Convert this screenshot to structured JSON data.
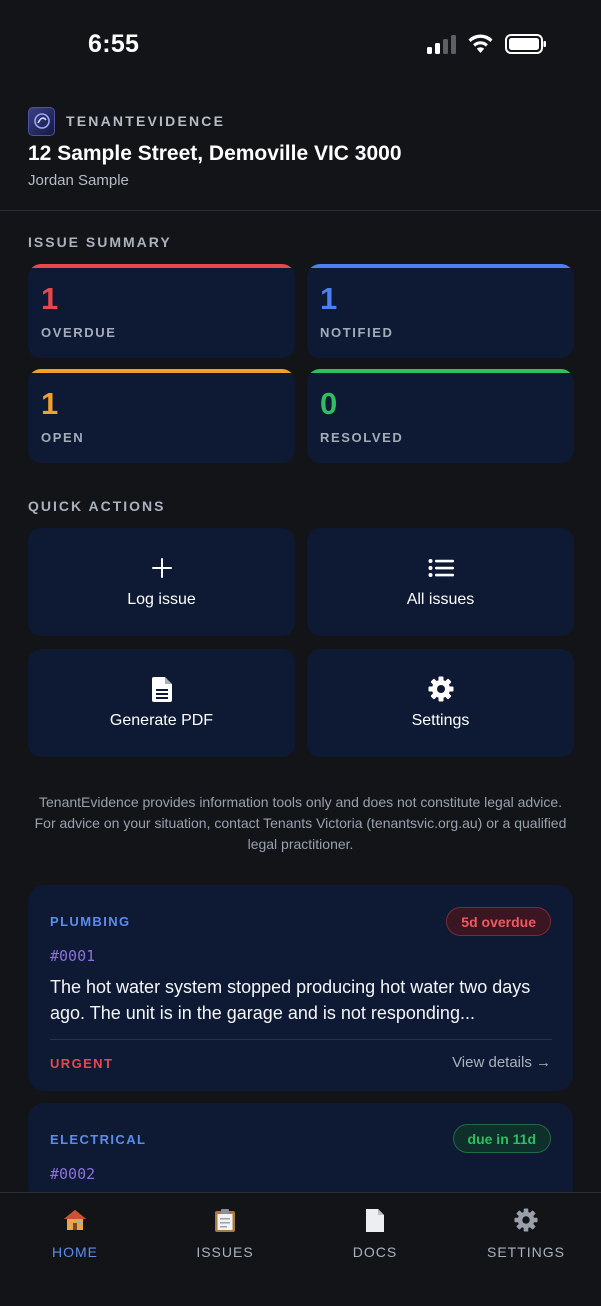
{
  "status": {
    "time": "6:55"
  },
  "header": {
    "brand": "TENANTEVIDENCE",
    "address": "12 Sample Street, Demoville VIC 3000",
    "tenant": "Jordan Sample"
  },
  "summary": {
    "title": "ISSUE SUMMARY",
    "cards": [
      {
        "count": "1",
        "label": "OVERDUE",
        "color": "#e5484d"
      },
      {
        "count": "1",
        "label": "NOTIFIED",
        "color": "#4c7ff0"
      },
      {
        "count": "1",
        "label": "OPEN",
        "color": "#f0a02b"
      },
      {
        "count": "0",
        "label": "RESOLVED",
        "color": "#2fbf63"
      }
    ]
  },
  "quick_actions": {
    "title": "QUICK ACTIONS",
    "items": [
      {
        "label": "Log issue",
        "icon": "plus-icon"
      },
      {
        "label": "All issues",
        "icon": "list-icon"
      },
      {
        "label": "Generate PDF",
        "icon": "document-icon"
      },
      {
        "label": "Settings",
        "icon": "gear-icon"
      }
    ]
  },
  "disclaimer": "TenantEvidence provides information tools only and does not constitute legal advice. For advice on your situation, contact Tenants Victoria (tenantsvic.org.au) or a qualified legal practitioner.",
  "issues": [
    {
      "category": "PLUMBING",
      "due": "5d overdue",
      "number": "#0001",
      "description": "The hot water system stopped producing hot water two days ago. The unit is in the garage and is not responding...",
      "priority": "URGENT",
      "link": "View details →"
    },
    {
      "category": "ELECTRICAL",
      "due": "due in 11d",
      "number": "#0002"
    }
  ],
  "tabs": [
    {
      "label": "HOME",
      "icon": "house-icon",
      "active": true
    },
    {
      "label": "ISSUES",
      "icon": "clipboard-icon",
      "active": false
    },
    {
      "label": "DOCS",
      "icon": "page-icon",
      "active": false
    },
    {
      "label": "SETTINGS",
      "icon": "gear-icon",
      "active": false
    }
  ],
  "colors": {
    "background": "#121417",
    "card": "#0e1a33",
    "accent": "#5b8def",
    "danger": "#e5484d",
    "success": "#2fbf63"
  }
}
